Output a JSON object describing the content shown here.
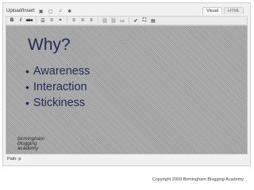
{
  "upload": {
    "label": "Upload/Insert",
    "icons": [
      "image-icon",
      "gallery-icon",
      "music-icon",
      "media-icon"
    ]
  },
  "mode_tabs": [
    "Visual",
    "HTML"
  ],
  "toolbar": {
    "bold": "B",
    "italic": "I",
    "strikethrough": "abc",
    "bullets": "☰",
    "numbers": "≡",
    "quote": "❝",
    "align_left": "≡",
    "align_center": "≡",
    "align_right": "≡",
    "link": "⛓",
    "unlink": "⛓",
    "more": "▭",
    "spell": "✔",
    "fullscreen": "⛶",
    "kitchen": "▤"
  },
  "slide": {
    "title": "Why?",
    "bullets": [
      "Awareness",
      "Interaction",
      "Stickiness"
    ],
    "bullet_char": "•"
  },
  "logo_lines": [
    "birmingham",
    "blogging",
    "academy"
  ],
  "path": "Path: p",
  "footer": "Copyright 2009 Birmingham Blogging Academy"
}
